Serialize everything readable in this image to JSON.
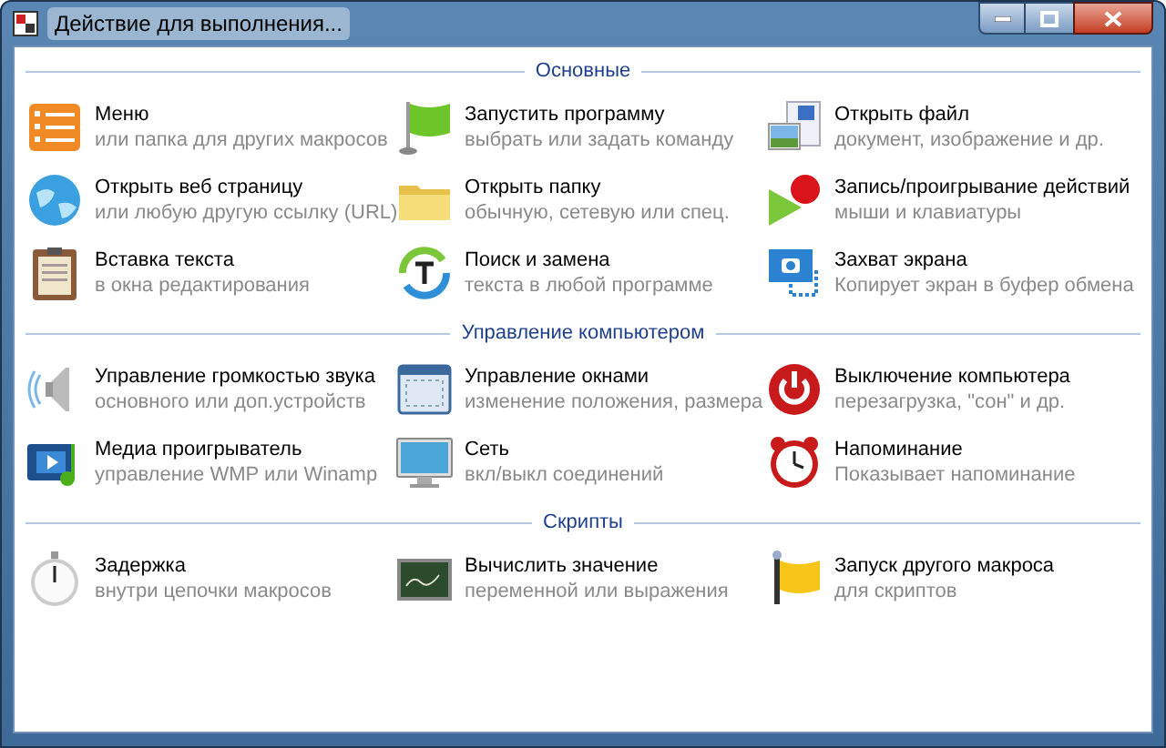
{
  "window": {
    "title": "Действие для выполнения..."
  },
  "sections": [
    {
      "title": "Основные",
      "items": [
        {
          "title": "Меню",
          "subtitle": "или папка для других макросов"
        },
        {
          "title": "Запустить программу",
          "subtitle": "выбрать или задать команду"
        },
        {
          "title": "Открыть файл",
          "subtitle": "документ, изображение и др."
        },
        {
          "title": "Открыть веб страницу",
          "subtitle": "или любую другую ссылку (URL)"
        },
        {
          "title": "Открыть папку",
          "subtitle": "обычную, сетевую или спец."
        },
        {
          "title": "Запись/проигрывание действий",
          "subtitle": "мыши и клавиатуры"
        },
        {
          "title": "Вставка текста",
          "subtitle": "в окна редактирования"
        },
        {
          "title": "Поиск и замена",
          "subtitle": "текста в любой программе"
        },
        {
          "title": "Захват экрана",
          "subtitle": "Копирует экран в буфер обмена"
        }
      ]
    },
    {
      "title": "Управление компьютером",
      "items": [
        {
          "title": "Управление громкостью звука",
          "subtitle": "основного или доп.устройств"
        },
        {
          "title": "Управление окнами",
          "subtitle": "изменение положения, размера"
        },
        {
          "title": "Выключение компьютера",
          "subtitle": "перезагрузка, \"сон\" и др."
        },
        {
          "title": "Медиа проигрыватель",
          "subtitle": "управление WMP или Winamp"
        },
        {
          "title": "Сеть",
          "subtitle": "вкл/выкл соединений"
        },
        {
          "title": "Напоминание",
          "subtitle": "Показывает напоминание"
        }
      ]
    },
    {
      "title": "Скрипты",
      "items": [
        {
          "title": "Задержка",
          "subtitle": "внутри цепочки макросов"
        },
        {
          "title": "Вычислить значение",
          "subtitle": "переменной или выражения"
        },
        {
          "title": "Запуск другого макроса",
          "subtitle": "для скриптов"
        }
      ]
    }
  ]
}
